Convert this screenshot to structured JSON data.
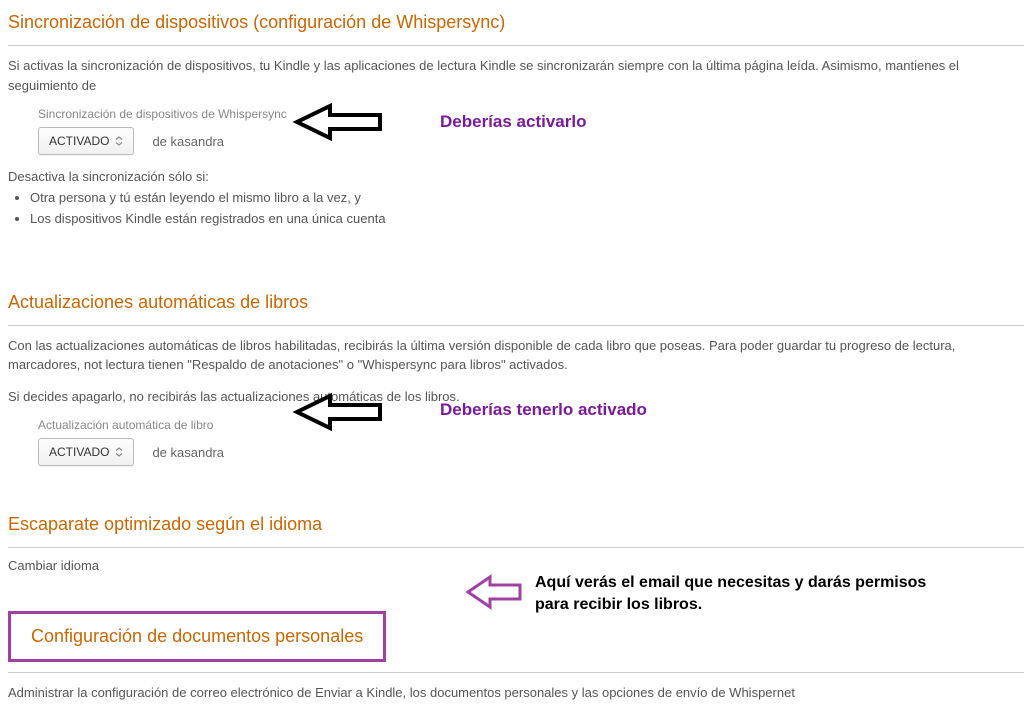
{
  "section1": {
    "title": "Sincronización de dispositivos (configuración de Whispersync)",
    "desc": "Si activas la sincronización de dispositivos, tu Kindle y las aplicaciones de lectura Kindle se sincronizarán siempre con la última página leída. Asimismo, mantienes el seguimiento de",
    "fieldLabel": "Sincronización de dispositivos de Whispersync",
    "dropdownValue": "ACTIVADO",
    "owner": "de kasandra",
    "listIntro": "Desactiva la sincronización sólo si:",
    "bullets": [
      "Otra persona y tú están leyendo el mismo libro a la vez, y",
      "Los dispositivos Kindle están registrados en una única cuenta"
    ]
  },
  "section2": {
    "title": "Actualizaciones automáticas de libros",
    "desc1": "Con las actualizaciones automáticas de libros habilitadas, recibirás la última versión disponible de cada libro que poseas. Para poder guardar tu progreso de lectura, marcadores, not lectura tienen \"Respaldo de anotaciones\" o \"Whispersync para libros\" activados.",
    "desc2": "Si decides apagarlo, no recibirás las actualizaciones automáticas de los libros.",
    "fieldLabel": "Actualización automática de libro",
    "dropdownValue": "ACTIVADO",
    "owner": "de kasandra"
  },
  "section3": {
    "title": "Escaparate optimizado según el idioma",
    "link": "Cambiar idioma"
  },
  "section4": {
    "title": "Configuración de documentos personales",
    "desc": "Administrar la configuración de correo electrónico de Enviar a Kindle, los documentos personales y las opciones de envío de Whispernet"
  },
  "annotations": {
    "a1": "Deberías activarlo",
    "a2": "Deberías tenerlo activado",
    "a3": "Aquí verás el email que necesitas y darás permisos para recibir los libros."
  }
}
